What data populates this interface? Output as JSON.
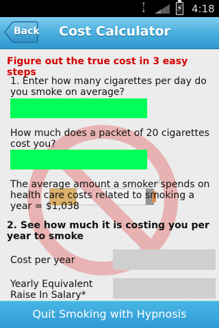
{
  "status_bar": {
    "time": "4:18"
  },
  "header": {
    "back_label": "Back",
    "title": "Cost Calculator"
  },
  "content": {
    "intro": "Figure out the true cost in 3 easy steps",
    "step1_question": "1. Enter how many cigarettes per day do you smoke on average?",
    "step1_value": "",
    "pack_question": "How much does a packet of 20 cigarettes cost you?",
    "pack_value": "",
    "health_note": "The average amount a smoker spends on health care costs related to smoking a year = $1,038",
    "step2_heading": "2. See how much it is costing you per year to smoke",
    "cost_per_year_label": "Cost per year",
    "cost_per_year_value": "",
    "salary_label": "Yearly Equivalent Raise In Salary*",
    "salary_value": ""
  },
  "bottom_button": {
    "label": "Quit Smoking with Hypnosis"
  },
  "colors": {
    "header": "#3aa3d6",
    "intro_text": "#d40000",
    "input_green": "#00ff58",
    "output_gray": "#cfcfcf"
  },
  "icons": {
    "watermark": "no-smoking-icon",
    "battery": "battery-charging-icon",
    "signal": "signal-icon",
    "data": "data-transfer-icon"
  }
}
